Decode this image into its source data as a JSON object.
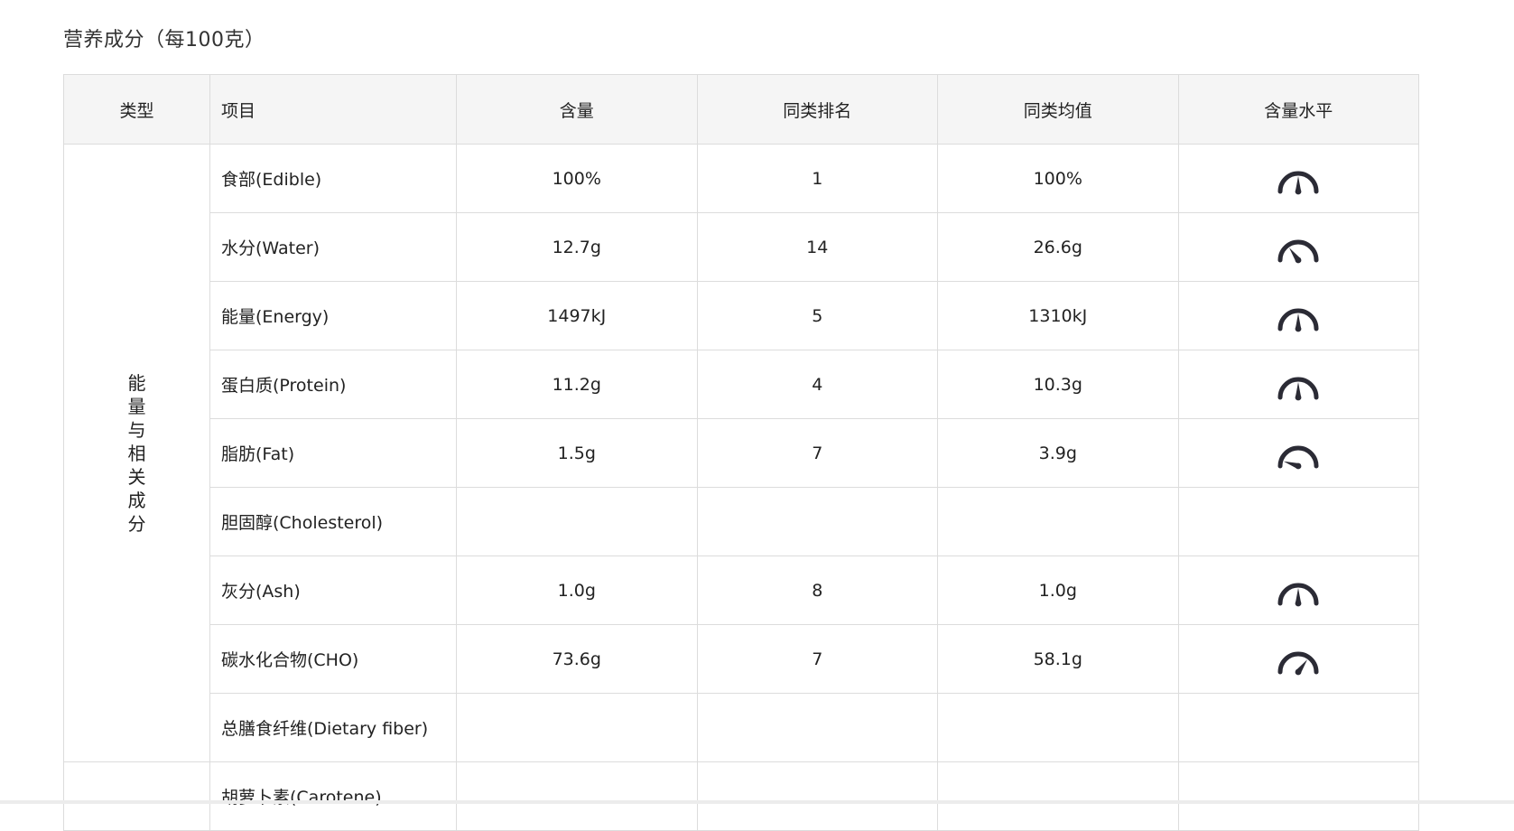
{
  "heading": "营养成分（每100克）",
  "headers": {
    "type": "类型",
    "item": "项目",
    "amount": "含量",
    "rank": "同类排名",
    "avg": "同类均值",
    "level": "含量水平"
  },
  "group1": {
    "label": "能量与相关成分"
  },
  "rows": [
    {
      "item": "食部(Edible)",
      "amount": "100%",
      "rank": "1",
      "avg": "100%",
      "level_icon": "gauge-high-icon",
      "level": 0.5
    },
    {
      "item": "水分(Water)",
      "amount": "12.7g",
      "rank": "14",
      "avg": "26.6g",
      "level_icon": "gauge-low-icon",
      "level": 0.3
    },
    {
      "item": "能量(Energy)",
      "amount": "1497kJ",
      "rank": "5",
      "avg": "1310kJ",
      "level_icon": "gauge-high-icon",
      "level": 0.5
    },
    {
      "item": "蛋白质(Protein)",
      "amount": "11.2g",
      "rank": "4",
      "avg": "10.3g",
      "level_icon": "gauge-high-icon",
      "level": 0.5
    },
    {
      "item": "脂肪(Fat)",
      "amount": "1.5g",
      "rank": "7",
      "avg": "3.9g",
      "level_icon": "gauge-very-low-icon",
      "level": 0.1
    },
    {
      "item": "胆固醇(Cholesterol)",
      "amount": "",
      "rank": "",
      "avg": "",
      "level_icon": "",
      "level": null
    },
    {
      "item": "灰分(Ash)",
      "amount": "1.0g",
      "rank": "8",
      "avg": "1.0g",
      "level_icon": "gauge-high-icon",
      "level": 0.5
    },
    {
      "item": "碳水化合物(CHO)",
      "amount": "73.6g",
      "rank": "7",
      "avg": "58.1g",
      "level_icon": "gauge-very-high-icon",
      "level": 0.7
    },
    {
      "item": "总膳食纤维(Dietary fiber)",
      "amount": "",
      "rank": "",
      "avg": "",
      "level_icon": "",
      "level": null
    }
  ],
  "next_row": {
    "item": "胡萝卜素(Carotene)"
  },
  "colors": {
    "gauge": "#2b2b35",
    "border": "#dcdcdc",
    "header_bg": "#f5f5f5"
  }
}
